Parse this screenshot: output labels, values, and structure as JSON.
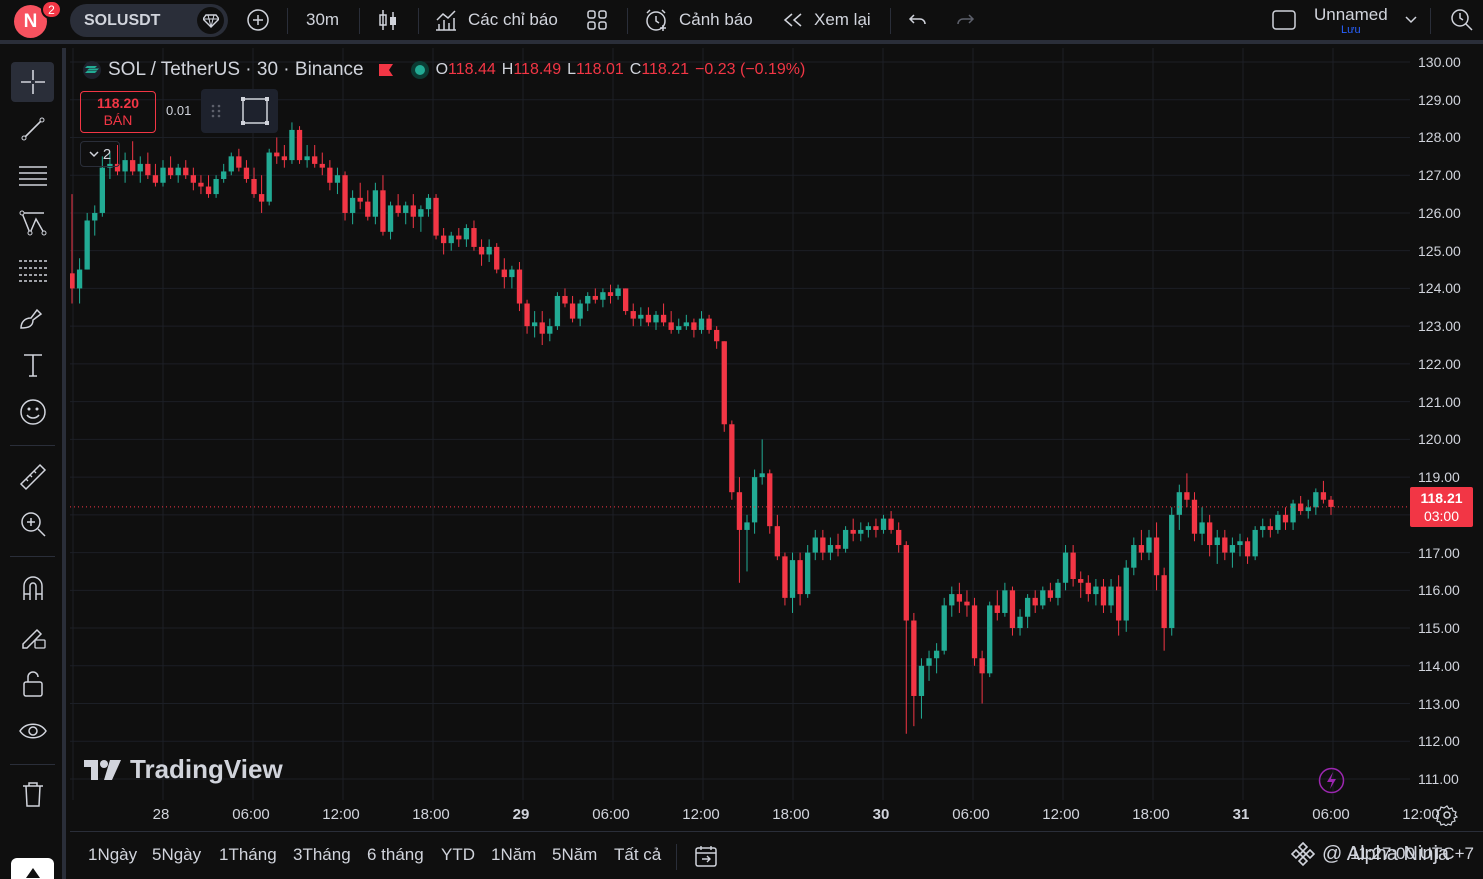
{
  "topbar": {
    "avatar_letter": "N",
    "notification_count": "2",
    "symbol": "SOLUSDT",
    "interval": "30m",
    "indicators_label": "Các chỉ báo",
    "alerts_label": "Cảnh báo",
    "replay_label": "Xem lại",
    "layout_name": "Unnamed",
    "save_label": "Lưu"
  },
  "legend": {
    "title": "SOL / TetherUS · 30 · Binance",
    "open_label": "O",
    "open": "118.44",
    "high_label": "H",
    "high": "118.49",
    "low_label": "L",
    "low": "118.01",
    "close_label": "C",
    "close": "118.21",
    "change": "−0.23 (−0.19%)",
    "sell_price": "118.20",
    "sell_label": "BÁN",
    "spread": "0.01",
    "indicator_count": "2"
  },
  "price_scale": {
    "ticks": [
      "130.00",
      "129.00",
      "128.00",
      "127.00",
      "126.00",
      "125.00",
      "124.00",
      "123.00",
      "122.00",
      "121.00",
      "120.00",
      "119.00",
      "118.00",
      "117.00",
      "116.00",
      "115.00",
      "114.00",
      "113.00",
      "112.00",
      "111.00"
    ],
    "last_price": "118.21",
    "countdown": "03:00"
  },
  "time_scale": {
    "ticks": [
      {
        "label": "28",
        "bold": false
      },
      {
        "label": "06:00",
        "bold": false
      },
      {
        "label": "12:00",
        "bold": false
      },
      {
        "label": "18:00",
        "bold": false
      },
      {
        "label": "29",
        "bold": true
      },
      {
        "label": "06:00",
        "bold": false
      },
      {
        "label": "12:00",
        "bold": false
      },
      {
        "label": "18:00",
        "bold": false
      },
      {
        "label": "30",
        "bold": true
      },
      {
        "label": "06:00",
        "bold": false
      },
      {
        "label": "12:00",
        "bold": false
      },
      {
        "label": "18:00",
        "bold": false
      },
      {
        "label": "31",
        "bold": true
      },
      {
        "label": "06:00",
        "bold": false
      },
      {
        "label": "12:00",
        "bold": false
      }
    ]
  },
  "branding": {
    "logo_text": "TradingView"
  },
  "bottombar": {
    "ranges": [
      "1Ngày",
      "5Ngày",
      "1Tháng",
      "3Tháng",
      "6 tháng",
      "YTD",
      "1Năm",
      "5Năm",
      "Tất cả"
    ],
    "time_readout": "11:27:00 UTC+7",
    "watermark": "@ Alpha Ninja"
  },
  "colors": {
    "up": "#22ab94",
    "down": "#f23645",
    "background": "#0f0f0f",
    "grid": "#1c1f26"
  },
  "chart_data": {
    "type": "candlestick",
    "symbol": "SOL / TetherUS",
    "interval": "30",
    "exchange": "Binance",
    "ylim": [
      111,
      130
    ],
    "last_price": 118.21,
    "candles": [
      [
        124.4,
        126.5,
        123.6,
        124.0
      ],
      [
        124.0,
        124.8,
        123.6,
        124.5
      ],
      [
        124.5,
        126.0,
        124.5,
        125.8
      ],
      [
        125.8,
        126.2,
        125.4,
        126.0
      ],
      [
        126.0,
        127.5,
        125.9,
        127.2
      ],
      [
        127.2,
        127.6,
        126.9,
        127.3
      ],
      [
        127.3,
        127.8,
        127.0,
        127.1
      ],
      [
        127.1,
        127.6,
        126.8,
        127.4
      ],
      [
        127.4,
        127.9,
        127.0,
        127.1
      ],
      [
        127.1,
        127.5,
        126.8,
        127.3
      ],
      [
        127.3,
        127.6,
        126.9,
        127.0
      ],
      [
        127.0,
        127.3,
        126.7,
        126.8
      ],
      [
        126.8,
        127.4,
        126.7,
        127.2
      ],
      [
        127.2,
        127.5,
        126.9,
        127.0
      ],
      [
        127.0,
        127.3,
        126.8,
        127.2
      ],
      [
        127.2,
        127.4,
        126.9,
        127.0
      ],
      [
        127.0,
        127.2,
        126.6,
        126.8
      ],
      [
        126.8,
        127.0,
        126.5,
        126.7
      ],
      [
        126.7,
        127.0,
        126.4,
        126.5
      ],
      [
        126.5,
        127.0,
        126.4,
        126.9
      ],
      [
        126.9,
        127.3,
        126.8,
        127.1
      ],
      [
        127.1,
        127.6,
        127.0,
        127.5
      ],
      [
        127.5,
        127.7,
        127.1,
        127.2
      ],
      [
        127.2,
        127.4,
        126.8,
        126.9
      ],
      [
        126.9,
        127.2,
        126.4,
        126.5
      ],
      [
        126.5,
        127.0,
        126.0,
        126.3
      ],
      [
        126.3,
        127.7,
        126.2,
        127.6
      ],
      [
        127.6,
        128.0,
        127.3,
        127.5
      ],
      [
        127.5,
        127.8,
        127.2,
        127.4
      ],
      [
        127.4,
        128.4,
        127.3,
        128.2
      ],
      [
        128.2,
        128.3,
        127.3,
        127.4
      ],
      [
        127.4,
        127.8,
        127.2,
        127.5
      ],
      [
        127.5,
        127.8,
        127.2,
        127.3
      ],
      [
        127.3,
        127.6,
        127.0,
        127.2
      ],
      [
        127.2,
        127.4,
        126.6,
        126.8
      ],
      [
        126.8,
        127.2,
        126.5,
        127.0
      ],
      [
        127.0,
        127.1,
        125.8,
        126.0
      ],
      [
        126.0,
        126.6,
        125.7,
        126.4
      ],
      [
        126.4,
        126.8,
        126.1,
        126.3
      ],
      [
        126.3,
        126.6,
        125.8,
        125.9
      ],
      [
        125.9,
        126.8,
        125.7,
        126.6
      ],
      [
        126.6,
        127.0,
        125.4,
        125.5
      ],
      [
        125.5,
        126.3,
        125.3,
        126.2
      ],
      [
        126.2,
        126.5,
        125.9,
        126.0
      ],
      [
        126.0,
        126.3,
        125.7,
        126.2
      ],
      [
        126.2,
        126.5,
        125.6,
        125.9
      ],
      [
        125.9,
        126.2,
        125.5,
        126.1
      ],
      [
        126.1,
        126.5,
        125.9,
        126.4
      ],
      [
        126.4,
        126.5,
        125.3,
        125.4
      ],
      [
        125.4,
        125.6,
        124.9,
        125.2
      ],
      [
        125.2,
        125.5,
        125.0,
        125.4
      ],
      [
        125.4,
        125.6,
        125.1,
        125.3
      ],
      [
        125.3,
        125.7,
        125.1,
        125.6
      ],
      [
        125.6,
        125.8,
        125.0,
        125.1
      ],
      [
        125.1,
        125.3,
        124.6,
        124.9
      ],
      [
        124.9,
        125.3,
        124.7,
        125.1
      ],
      [
        125.1,
        125.2,
        124.4,
        124.5
      ],
      [
        124.5,
        124.8,
        124.0,
        124.3
      ],
      [
        124.3,
        124.6,
        124.0,
        124.5
      ],
      [
        124.5,
        124.7,
        123.4,
        123.6
      ],
      [
        123.6,
        123.7,
        122.8,
        123.0
      ],
      [
        123.0,
        123.4,
        122.7,
        123.1
      ],
      [
        123.1,
        123.4,
        122.5,
        122.8
      ],
      [
        122.8,
        123.2,
        122.6,
        123.0
      ],
      [
        123.0,
        123.9,
        122.9,
        123.8
      ],
      [
        123.8,
        124.0,
        123.5,
        123.6
      ],
      [
        123.6,
        123.8,
        123.1,
        123.2
      ],
      [
        123.2,
        123.7,
        123.0,
        123.6
      ],
      [
        123.6,
        123.9,
        123.4,
        123.8
      ],
      [
        123.8,
        124.0,
        123.6,
        123.7
      ],
      [
        123.7,
        124.0,
        123.5,
        123.9
      ],
      [
        123.9,
        124.1,
        123.6,
        123.8
      ],
      [
        123.8,
        124.1,
        123.7,
        124.0
      ],
      [
        124.0,
        124.0,
        123.3,
        123.4
      ],
      [
        123.4,
        123.6,
        123.0,
        123.2
      ],
      [
        123.2,
        123.5,
        123.0,
        123.3
      ],
      [
        123.3,
        123.5,
        123.0,
        123.1
      ],
      [
        123.1,
        123.4,
        122.9,
        123.3
      ],
      [
        123.3,
        123.6,
        123.0,
        123.1
      ],
      [
        123.1,
        123.4,
        122.8,
        122.9
      ],
      [
        122.9,
        123.2,
        122.8,
        123.0
      ],
      [
        123.0,
        123.3,
        122.9,
        123.1
      ],
      [
        123.1,
        123.2,
        122.7,
        122.9
      ],
      [
        122.9,
        123.4,
        122.8,
        123.2
      ],
      [
        123.2,
        123.3,
        122.8,
        122.9
      ],
      [
        122.9,
        123.0,
        122.4,
        122.6
      ],
      [
        122.6,
        122.6,
        120.2,
        120.4
      ],
      [
        120.4,
        120.5,
        118.4,
        118.6
      ],
      [
        118.6,
        119.0,
        116.2,
        117.6
      ],
      [
        117.6,
        118.0,
        116.5,
        117.8
      ],
      [
        117.8,
        119.2,
        117.5,
        119.0
      ],
      [
        119.0,
        120.0,
        118.8,
        119.1
      ],
      [
        119.1,
        119.2,
        117.5,
        117.7
      ],
      [
        117.7,
        118.0,
        116.8,
        116.9
      ],
      [
        116.9,
        117.0,
        115.6,
        115.8
      ],
      [
        115.8,
        117.0,
        115.4,
        116.8
      ],
      [
        116.8,
        117.0,
        115.6,
        115.9
      ],
      [
        115.9,
        117.2,
        115.8,
        117.0
      ],
      [
        117.0,
        117.6,
        116.8,
        117.4
      ],
      [
        117.4,
        117.6,
        116.8,
        117.0
      ],
      [
        117.0,
        117.4,
        116.8,
        117.2
      ],
      [
        117.2,
        117.5,
        116.9,
        117.1
      ],
      [
        117.1,
        117.7,
        117.0,
        117.6
      ],
      [
        117.6,
        117.9,
        117.3,
        117.5
      ],
      [
        117.5,
        117.8,
        117.3,
        117.6
      ],
      [
        117.6,
        117.8,
        117.4,
        117.7
      ],
      [
        117.7,
        117.9,
        117.4,
        117.6
      ],
      [
        117.6,
        118.0,
        117.5,
        117.9
      ],
      [
        117.9,
        118.1,
        117.5,
        117.6
      ],
      [
        117.6,
        117.8,
        117.0,
        117.2
      ],
      [
        117.2,
        117.3,
        112.2,
        115.2
      ],
      [
        115.2,
        115.4,
        112.4,
        113.2
      ],
      [
        113.2,
        114.2,
        112.6,
        114.0
      ],
      [
        114.0,
        114.4,
        113.6,
        114.2
      ],
      [
        114.2,
        114.6,
        113.8,
        114.4
      ],
      [
        114.4,
        115.8,
        114.3,
        115.6
      ],
      [
        115.6,
        116.1,
        115.3,
        115.9
      ],
      [
        115.9,
        116.2,
        115.4,
        115.7
      ],
      [
        115.7,
        116.0,
        115.3,
        115.6
      ],
      [
        115.6,
        115.8,
        114.0,
        114.2
      ],
      [
        114.2,
        114.4,
        113.0,
        113.8
      ],
      [
        113.8,
        115.7,
        113.7,
        115.6
      ],
      [
        115.6,
        116.0,
        115.2,
        115.4
      ],
      [
        115.4,
        116.2,
        115.3,
        116.0
      ],
      [
        116.0,
        116.1,
        114.8,
        115.0
      ],
      [
        115.0,
        115.5,
        114.8,
        115.3
      ],
      [
        115.3,
        115.9,
        115.0,
        115.8
      ],
      [
        115.8,
        116.0,
        115.4,
        115.6
      ],
      [
        115.6,
        116.1,
        115.5,
        116.0
      ],
      [
        116.0,
        116.2,
        115.7,
        115.8
      ],
      [
        115.8,
        116.3,
        115.6,
        116.2
      ],
      [
        116.2,
        117.2,
        116.0,
        117.0
      ],
      [
        117.0,
        117.2,
        116.1,
        116.3
      ],
      [
        116.3,
        116.5,
        115.8,
        116.2
      ],
      [
        116.2,
        116.4,
        115.7,
        115.9
      ],
      [
        115.9,
        116.3,
        115.6,
        116.1
      ],
      [
        116.1,
        116.3,
        115.4,
        115.6
      ],
      [
        115.6,
        116.3,
        115.4,
        116.1
      ],
      [
        116.1,
        116.4,
        114.8,
        115.2
      ],
      [
        115.2,
        116.8,
        114.9,
        116.6
      ],
      [
        116.6,
        117.4,
        116.4,
        117.2
      ],
      [
        117.2,
        117.6,
        116.8,
        117.0
      ],
      [
        117.0,
        117.6,
        116.8,
        117.4
      ],
      [
        117.4,
        117.8,
        116.0,
        116.4
      ],
      [
        116.4,
        116.6,
        114.4,
        115.0
      ],
      [
        115.0,
        118.2,
        114.8,
        118.0
      ],
      [
        118.0,
        118.8,
        117.6,
        118.6
      ],
      [
        118.6,
        119.1,
        118.2,
        118.4
      ],
      [
        118.4,
        118.6,
        117.3,
        117.5
      ],
      [
        117.5,
        118.2,
        117.2,
        117.8
      ],
      [
        117.8,
        118.0,
        116.9,
        117.2
      ],
      [
        117.2,
        117.6,
        116.7,
        117.4
      ],
      [
        117.4,
        117.6,
        116.8,
        117.0
      ],
      [
        117.0,
        117.4,
        116.6,
        117.2
      ],
      [
        117.2,
        117.5,
        116.9,
        117.3
      ],
      [
        117.3,
        117.4,
        116.7,
        116.9
      ],
      [
        116.9,
        117.7,
        116.8,
        117.6
      ],
      [
        117.6,
        117.9,
        117.4,
        117.7
      ],
      [
        117.7,
        117.9,
        117.4,
        117.6
      ],
      [
        117.6,
        118.1,
        117.5,
        118.0
      ],
      [
        118.0,
        118.2,
        117.6,
        117.8
      ],
      [
        117.8,
        118.4,
        117.6,
        118.3
      ],
      [
        118.3,
        118.5,
        118.0,
        118.1
      ],
      [
        118.1,
        118.4,
        117.9,
        118.2
      ],
      [
        118.2,
        118.7,
        118.0,
        118.6
      ],
      [
        118.6,
        118.9,
        118.3,
        118.4
      ],
      [
        118.4,
        118.5,
        118.0,
        118.21
      ]
    ]
  }
}
